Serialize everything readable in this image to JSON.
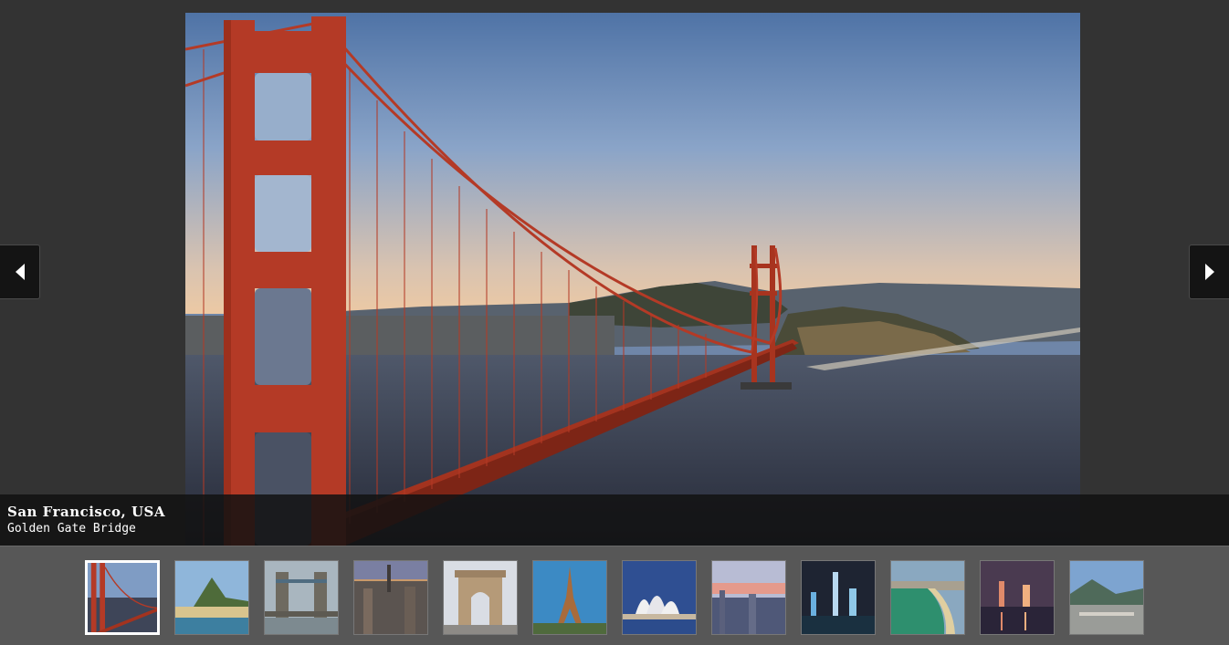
{
  "viewer": {
    "caption": {
      "title": "San Francisco, USA",
      "subtitle": "Golden Gate Bridge"
    },
    "nav": {
      "prev_icon": "triangle-left-icon",
      "next_icon": "triangle-right-icon"
    },
    "active_index": 0,
    "thumbnails": [
      {
        "id": "golden-gate-bridge"
      },
      {
        "id": "rio-sugarloaf"
      },
      {
        "id": "tower-bridge"
      },
      {
        "id": "new-york-skyline"
      },
      {
        "id": "india-gate"
      },
      {
        "id": "eiffel-tower"
      },
      {
        "id": "sydney-opera-house"
      },
      {
        "id": "city-dusk"
      },
      {
        "id": "hong-kong-night"
      },
      {
        "id": "coastal-beach-city"
      },
      {
        "id": "night-skyline-reflection"
      },
      {
        "id": "harbor-city"
      }
    ]
  },
  "colors": {
    "background": "#333333",
    "thumb_strip": "#575757",
    "caption_bg": "#121212",
    "active_border": "#ffffff",
    "bridge_red": "#b43a26"
  }
}
